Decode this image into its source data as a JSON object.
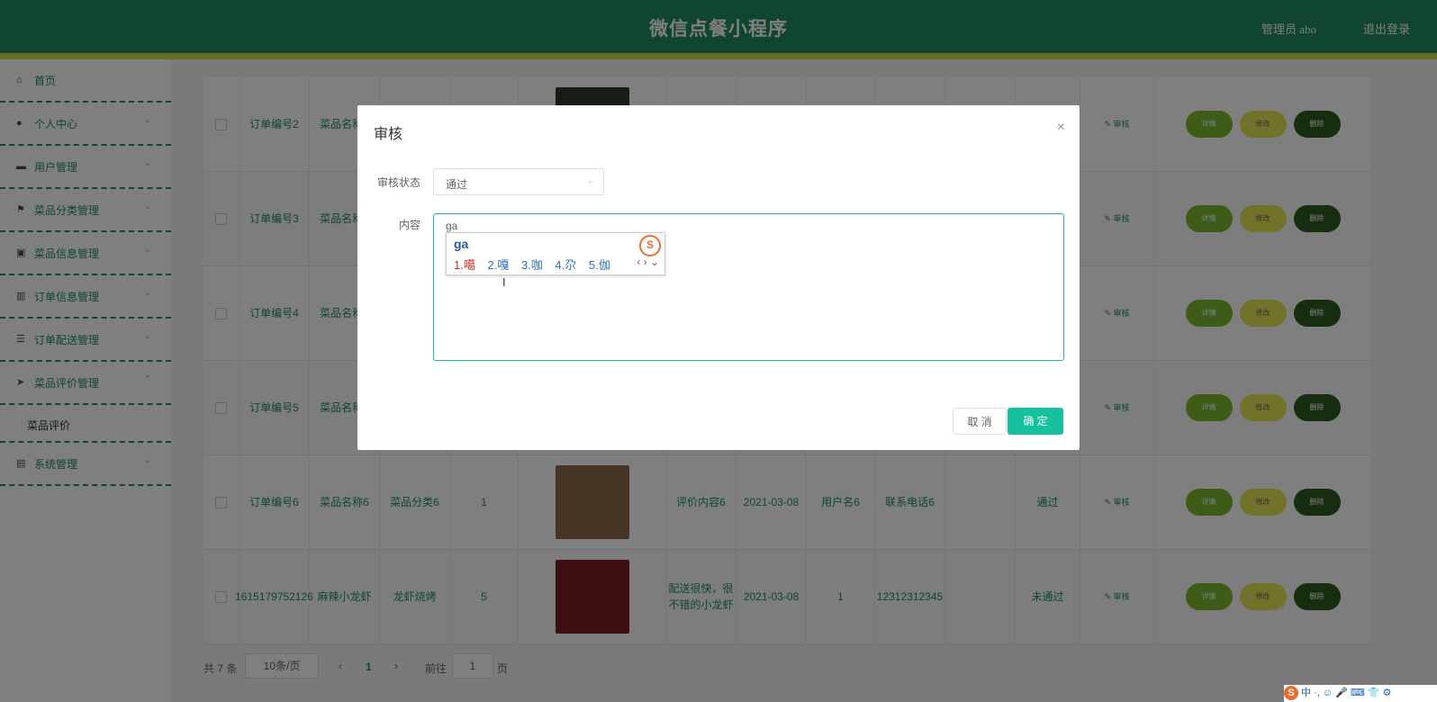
{
  "header": {
    "title": "微信点餐小程序",
    "user": "管理员 abo",
    "logout": "退出登录"
  },
  "sidebar": {
    "items": [
      {
        "label": "首页",
        "icon": "home-icon"
      },
      {
        "label": "个人中心",
        "icon": "user-icon"
      },
      {
        "label": "用户管理",
        "icon": "chat-icon"
      },
      {
        "label": "菜品分类管理",
        "icon": "flag-icon"
      },
      {
        "label": "菜品信息管理",
        "icon": "briefcase-icon"
      },
      {
        "label": "订单信息管理",
        "icon": "chart-icon"
      },
      {
        "label": "订单配送管理",
        "icon": "sliders-icon"
      },
      {
        "label": "菜品评价管理",
        "icon": "send-icon"
      },
      {
        "label": "系统管理",
        "icon": "clipboard-icon"
      }
    ],
    "sub_item": "菜品评价"
  },
  "table": {
    "rows": [
      {
        "order": "订单编号2",
        "dish": "菜品名称2",
        "category": "",
        "count": "",
        "content": "",
        "date": "",
        "user": "",
        "phone": "",
        "status": "",
        "thumb_color": "#2e3a2a"
      },
      {
        "order": "订单编号3",
        "dish": "菜品名称3",
        "category": "",
        "count": "",
        "content": "",
        "date": "",
        "user": "",
        "phone": "",
        "status": "",
        "thumb_color": "#5a4a30"
      },
      {
        "order": "订单编号4",
        "dish": "菜品名称4",
        "category": "",
        "count": "",
        "content": "",
        "date": "",
        "user": "",
        "phone": "",
        "status": "",
        "thumb_color": "#6a5a2a"
      },
      {
        "order": "订单编号5",
        "dish": "菜品名称5",
        "category": "",
        "count": "",
        "content": "",
        "date": "",
        "user": "",
        "phone": "",
        "status": "",
        "thumb_color": "#6b6a1e"
      },
      {
        "order": "订单编号6",
        "dish": "菜品名称6",
        "category": "菜品分类6",
        "count": "1",
        "content": "评价内容6",
        "date": "2021-03-08",
        "user": "用户名6",
        "phone": "联系电话6",
        "status": "通过",
        "thumb_color": "#8a6b4a"
      },
      {
        "order": "1615179752126",
        "dish": "麻辣小龙虾",
        "category": "龙虾烧烤",
        "count": "5",
        "content": "配送很快，很不错的小龙虾",
        "date": "2021-03-08",
        "user": "1",
        "phone": "12312312345",
        "status": "未通过",
        "thumb_color": "#7a1f1f"
      }
    ],
    "audit_label": "审核",
    "detail_label": "详情",
    "edit_label": "修改",
    "delete_label": "删除"
  },
  "pager": {
    "total": "共 7 条",
    "size": "10条/页",
    "current": "1",
    "goto": "前往",
    "page_input": "1",
    "page_unit": "页"
  },
  "dialog": {
    "title": "审核",
    "status_label": "审核状态",
    "status_value": "通过",
    "content_label": "内容",
    "content_value": "ga",
    "cancel": "取 消",
    "confirm": "确 定"
  },
  "ime": {
    "composition": "ga",
    "candidates": [
      "1.噶",
      "2.嘎",
      "3.咖",
      "4.尕",
      "5.伽"
    ]
  },
  "tray": {
    "text": "中 ·, ☺ 🎤 ⌨ 👕 ⚙"
  }
}
